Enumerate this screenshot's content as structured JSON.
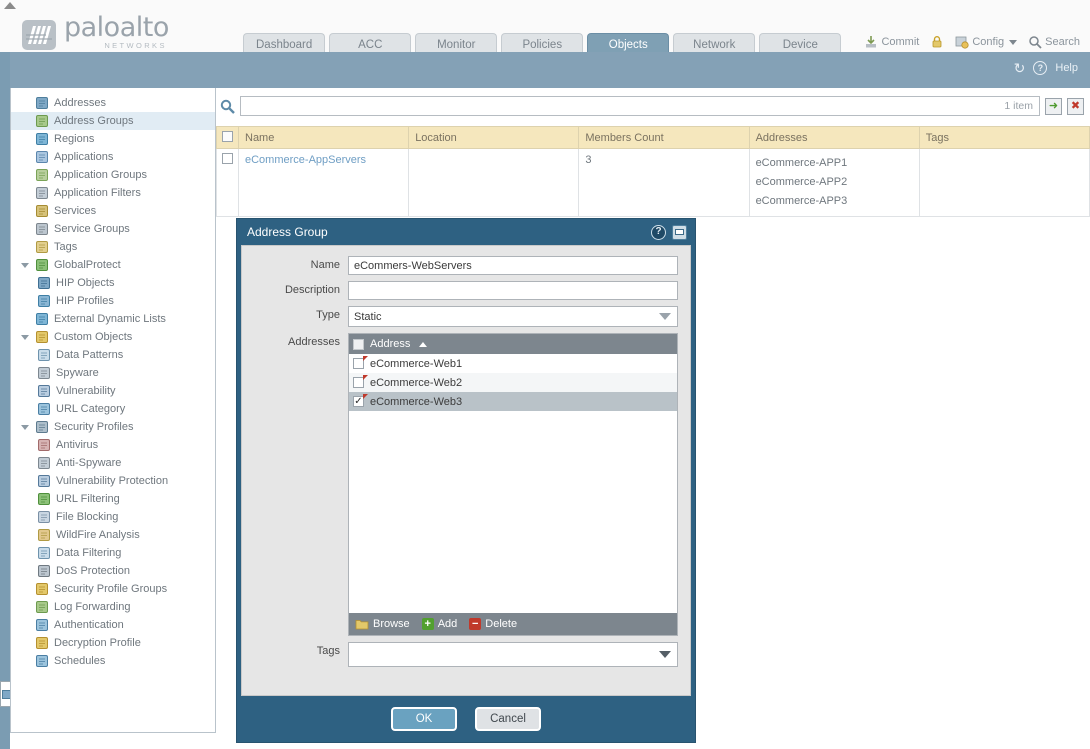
{
  "brand": {
    "name": "paloalto",
    "tagline": "NETWORKS"
  },
  "nav": {
    "tabs": [
      {
        "label": "Dashboard",
        "active": false
      },
      {
        "label": "ACC",
        "active": false
      },
      {
        "label": "Monitor",
        "active": false
      },
      {
        "label": "Policies",
        "active": false
      },
      {
        "label": "Objects",
        "active": true
      },
      {
        "label": "Network",
        "active": false
      },
      {
        "label": "Device",
        "active": false
      }
    ],
    "actions": [
      {
        "label": "Commit",
        "icon": "commit-icon"
      },
      {
        "label": "",
        "icon": "lock-icon"
      },
      {
        "label": "Config",
        "icon": "config-icon",
        "caret": true
      },
      {
        "label": "Search",
        "icon": "search-icon"
      }
    ]
  },
  "toolbar": {
    "refresh_icon": "refresh-icon",
    "help_label": "Help",
    "help_icon": "help-icon"
  },
  "sidebar": {
    "items": [
      {
        "label": "Addresses",
        "level": 0,
        "expandable": false,
        "selected": false,
        "icon": "addresses-icon"
      },
      {
        "label": "Address Groups",
        "level": 0,
        "expandable": false,
        "selected": true,
        "icon": "address-groups-icon"
      },
      {
        "label": "Regions",
        "level": 0,
        "expandable": false,
        "selected": false,
        "icon": "regions-icon"
      },
      {
        "label": "Applications",
        "level": 0,
        "expandable": false,
        "selected": false,
        "icon": "applications-icon"
      },
      {
        "label": "Application Groups",
        "level": 0,
        "expandable": false,
        "selected": false,
        "icon": "application-groups-icon"
      },
      {
        "label": "Application Filters",
        "level": 0,
        "expandable": false,
        "selected": false,
        "icon": "application-filters-icon"
      },
      {
        "label": "Services",
        "level": 0,
        "expandable": false,
        "selected": false,
        "icon": "services-icon"
      },
      {
        "label": "Service Groups",
        "level": 0,
        "expandable": false,
        "selected": false,
        "icon": "service-groups-icon"
      },
      {
        "label": "Tags",
        "level": 0,
        "expandable": false,
        "selected": false,
        "icon": "tags-icon"
      },
      {
        "label": "GlobalProtect",
        "level": 0,
        "expandable": true,
        "selected": false,
        "icon": "globalprotect-icon"
      },
      {
        "label": "HIP Objects",
        "level": 1,
        "expandable": false,
        "selected": false,
        "icon": "hip-objects-icon"
      },
      {
        "label": "HIP Profiles",
        "level": 1,
        "expandable": false,
        "selected": false,
        "icon": "hip-profiles-icon"
      },
      {
        "label": "External Dynamic Lists",
        "level": 0,
        "expandable": false,
        "selected": false,
        "icon": "external-dynamic-lists-icon"
      },
      {
        "label": "Custom Objects",
        "level": 0,
        "expandable": true,
        "selected": false,
        "icon": "custom-objects-icon"
      },
      {
        "label": "Data Patterns",
        "level": 1,
        "expandable": false,
        "selected": false,
        "icon": "data-patterns-icon"
      },
      {
        "label": "Spyware",
        "level": 1,
        "expandable": false,
        "selected": false,
        "icon": "spyware-icon"
      },
      {
        "label": "Vulnerability",
        "level": 1,
        "expandable": false,
        "selected": false,
        "icon": "vulnerability-icon"
      },
      {
        "label": "URL Category",
        "level": 1,
        "expandable": false,
        "selected": false,
        "icon": "url-category-icon"
      },
      {
        "label": "Security Profiles",
        "level": 0,
        "expandable": true,
        "selected": false,
        "icon": "security-profiles-icon"
      },
      {
        "label": "Antivirus",
        "level": 1,
        "expandable": false,
        "selected": false,
        "icon": "antivirus-icon"
      },
      {
        "label": "Anti-Spyware",
        "level": 1,
        "expandable": false,
        "selected": false,
        "icon": "anti-spyware-icon"
      },
      {
        "label": "Vulnerability Protection",
        "level": 1,
        "expandable": false,
        "selected": false,
        "icon": "vulnerability-protection-icon"
      },
      {
        "label": "URL Filtering",
        "level": 1,
        "expandable": false,
        "selected": false,
        "icon": "url-filtering-icon"
      },
      {
        "label": "File Blocking",
        "level": 1,
        "expandable": false,
        "selected": false,
        "icon": "file-blocking-icon"
      },
      {
        "label": "WildFire Analysis",
        "level": 1,
        "expandable": false,
        "selected": false,
        "icon": "wildfire-analysis-icon"
      },
      {
        "label": "Data Filtering",
        "level": 1,
        "expandable": false,
        "selected": false,
        "icon": "data-filtering-icon"
      },
      {
        "label": "DoS Protection",
        "level": 1,
        "expandable": false,
        "selected": false,
        "icon": "dos-protection-icon"
      },
      {
        "label": "Security Profile Groups",
        "level": 0,
        "expandable": false,
        "selected": false,
        "icon": "security-profile-groups-icon"
      },
      {
        "label": "Log Forwarding",
        "level": 0,
        "expandable": false,
        "selected": false,
        "icon": "log-forwarding-icon"
      },
      {
        "label": "Authentication",
        "level": 0,
        "expandable": false,
        "selected": false,
        "icon": "authentication-icon"
      },
      {
        "label": "Decryption Profile",
        "level": 0,
        "expandable": false,
        "selected": false,
        "icon": "decryption-profile-icon"
      },
      {
        "label": "Schedules",
        "level": 0,
        "expandable": false,
        "selected": false,
        "icon": "schedules-icon"
      }
    ]
  },
  "search": {
    "value": "",
    "item_count": "1 item",
    "go_icon": "arrow-right-icon",
    "clear_icon": "close-icon"
  },
  "table": {
    "columns": [
      "Name",
      "Location",
      "Members Count",
      "Addresses",
      "Tags"
    ],
    "rows": [
      {
        "name": "eCommerce-AppServers",
        "location": "",
        "members_count": "3",
        "addresses": [
          "eCommerce-APP1",
          "eCommerce-APP2",
          "eCommerce-APP3"
        ],
        "tags": ""
      }
    ]
  },
  "dialog": {
    "title": "Address Group",
    "fields": {
      "name_label": "Name",
      "name_value": "eCommers-WebServers",
      "description_label": "Description",
      "description_value": "",
      "type_label": "Type",
      "type_value": "Static",
      "addresses_label": "Addresses",
      "tags_label": "Tags",
      "tags_value": ""
    },
    "address_list": {
      "header": "Address",
      "sort": "asc",
      "rows": [
        {
          "label": "eCommerce-Web1",
          "checked": false,
          "selected": false
        },
        {
          "label": "eCommerce-Web2",
          "checked": false,
          "selected": false
        },
        {
          "label": "eCommerce-Web3",
          "checked": true,
          "selected": true
        }
      ],
      "footer_buttons": [
        {
          "label": "Browse",
          "icon": "folder-icon"
        },
        {
          "label": "Add",
          "icon": "plus-icon"
        },
        {
          "label": "Delete",
          "icon": "minus-icon"
        }
      ]
    },
    "buttons": {
      "ok": "OK",
      "cancel": "Cancel"
    }
  },
  "colors": {
    "accent_blue": "#7fa0b4",
    "dialog_blue": "#2e6182",
    "table_header": "#f5e7bd",
    "ok_button": "#6aa2c0",
    "selected_row": "#b9c2c8"
  }
}
